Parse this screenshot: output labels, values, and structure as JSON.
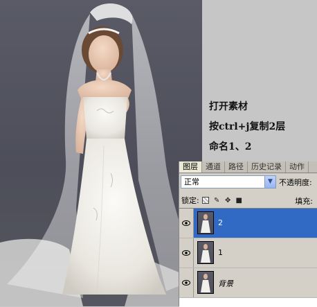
{
  "instructions": {
    "line1": "打开素材",
    "line2": "按ctrl+j复制2层",
    "line3": "命名1、2"
  },
  "layers_panel": {
    "tabs": [
      {
        "label": "图层",
        "active": true
      },
      {
        "label": "通道",
        "active": false
      },
      {
        "label": "路径",
        "active": false
      },
      {
        "label": "历史记录",
        "active": false
      },
      {
        "label": "动作",
        "active": false
      }
    ],
    "blend_mode": "正常",
    "opacity_label": "不透明度:",
    "lock_label": "锁定:",
    "fill_label": "填充:",
    "layers": [
      {
        "name": "2",
        "selected": true,
        "visible": true
      },
      {
        "name": "1",
        "selected": false,
        "visible": true
      },
      {
        "name": "背景",
        "selected": false,
        "visible": true
      }
    ]
  },
  "colors": {
    "selection": "#316ac5",
    "panel_bg": "#d4d0c8",
    "photo_bg": "#53545e"
  }
}
